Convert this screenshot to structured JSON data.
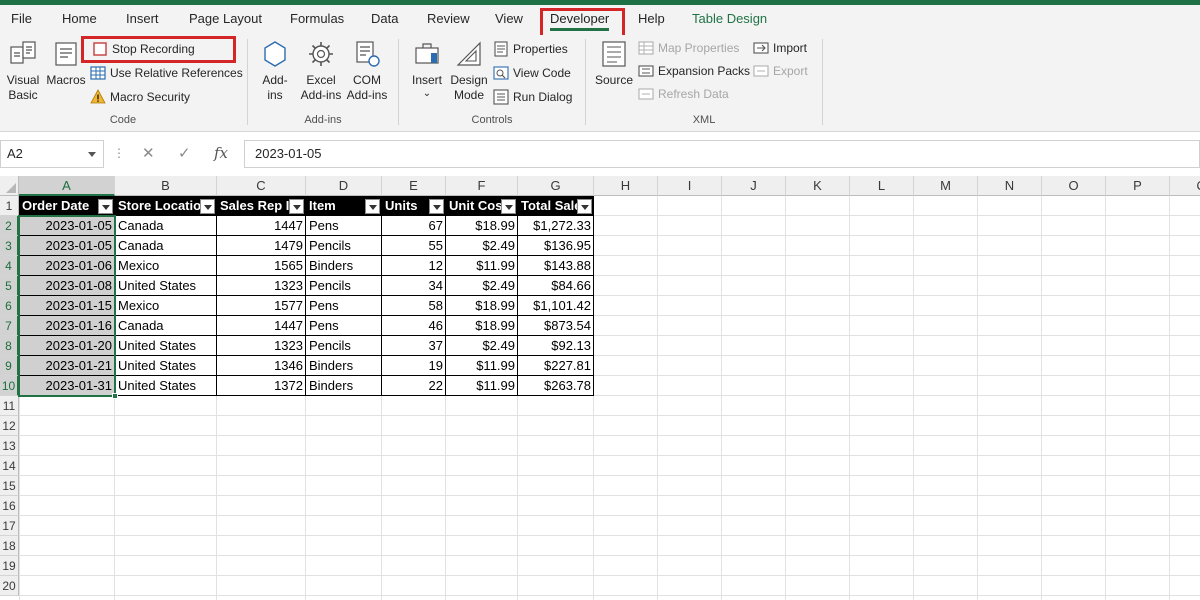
{
  "ribbon_tabs": [
    {
      "label": "File"
    },
    {
      "label": "Home"
    },
    {
      "label": "Insert"
    },
    {
      "label": "Page Layout"
    },
    {
      "label": "Formulas"
    },
    {
      "label": "Data"
    },
    {
      "label": "Review"
    },
    {
      "label": "View"
    },
    {
      "label": "Developer",
      "active": true
    },
    {
      "label": "Help"
    },
    {
      "label": "Table Design"
    }
  ],
  "ribbon": {
    "code": {
      "label": "Code",
      "visual_basic": "Visual Basic",
      "visual_basic_l1": "Visual",
      "visual_basic_l2": "Basic",
      "macros": "Macros",
      "stop_recording": "Stop Recording",
      "use_relative": "Use Relative References",
      "macro_security": "Macro Security"
    },
    "addins": {
      "label": "Add-ins",
      "addins_l1": "Add-",
      "addins_l2": "ins",
      "excel_l1": "Excel",
      "excel_l2": "Add-ins",
      "com_l1": "COM",
      "com_l2": "Add-ins"
    },
    "controls": {
      "label": "Controls",
      "insert": "Insert",
      "design_l1": "Design",
      "design_l2": "Mode",
      "properties": "Properties",
      "view_code": "View Code",
      "run_dialog": "Run Dialog"
    },
    "xml": {
      "label": "XML",
      "source": "Source",
      "map_properties": "Map Properties",
      "expansion_packs": "Expansion Packs",
      "refresh_data": "Refresh Data",
      "import": "Import",
      "export": "Export"
    }
  },
  "formula_bar": {
    "name_box": "A2",
    "fx_symbol": "fx",
    "value": "2023-01-05"
  },
  "columns": [
    "A",
    "B",
    "C",
    "D",
    "E",
    "F",
    "G",
    "H",
    "I",
    "J",
    "K",
    "L",
    "M",
    "N",
    "O",
    "P",
    "Q"
  ],
  "rows": [
    "1",
    "2",
    "3",
    "4",
    "5",
    "6",
    "7",
    "8",
    "9",
    "10",
    "11",
    "12",
    "13",
    "14",
    "15",
    "16",
    "17",
    "18",
    "19",
    "20"
  ],
  "selected_cell": "A2",
  "table": {
    "headers": [
      "Order Date",
      "Store Location",
      "Sales Rep ID",
      "Item",
      "Units",
      "Unit Cost",
      "Total Sales"
    ],
    "rows": [
      [
        "2023-01-05",
        "Canada",
        "1447",
        "Pens",
        "67",
        "$18.99",
        "$1,272.33"
      ],
      [
        "2023-01-05",
        "Canada",
        "1479",
        "Pencils",
        "55",
        "$2.49",
        "$136.95"
      ],
      [
        "2023-01-06",
        "Mexico",
        "1565",
        "Binders",
        "12",
        "$11.99",
        "$143.88"
      ],
      [
        "2023-01-08",
        "United States",
        "1323",
        "Pencils",
        "34",
        "$2.49",
        "$84.66"
      ],
      [
        "2023-01-15",
        "Mexico",
        "1577",
        "Pens",
        "58",
        "$18.99",
        "$1,101.42"
      ],
      [
        "2023-01-16",
        "Canada",
        "1447",
        "Pens",
        "46",
        "$18.99",
        "$873.54"
      ],
      [
        "2023-01-20",
        "United States",
        "1323",
        "Pencils",
        "37",
        "$2.49",
        "$92.13"
      ],
      [
        "2023-01-21",
        "United States",
        "1346",
        "Binders",
        "19",
        "$11.99",
        "$227.81"
      ],
      [
        "2023-01-31",
        "United States",
        "1372",
        "Binders",
        "22",
        "$11.99",
        "$263.78"
      ]
    ]
  },
  "colors": {
    "accent": "#217346",
    "highlight": "#d42626",
    "table_header_bg": "#000000"
  }
}
